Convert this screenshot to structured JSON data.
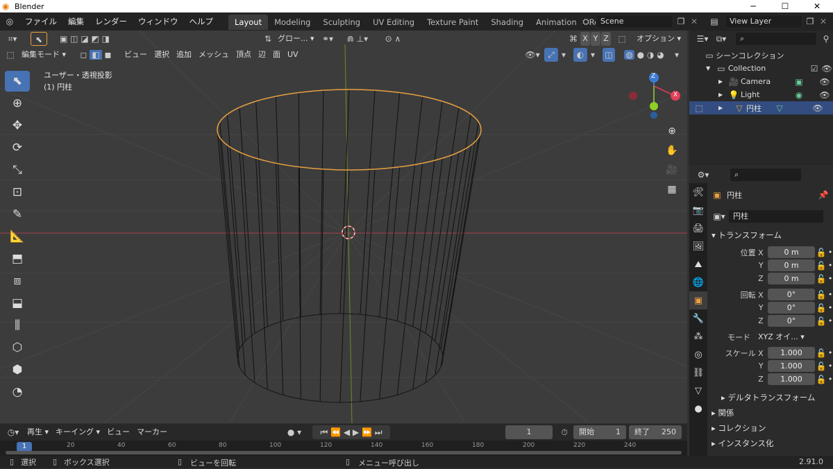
{
  "window": {
    "title": "Blender",
    "minimize": "─",
    "maximize": "☐",
    "close": "✕"
  },
  "menu": {
    "items": [
      "ファイル",
      "編集",
      "レンダー",
      "ウィンドウ",
      "ヘルプ"
    ],
    "workspaces": [
      "Layout",
      "Modeling",
      "Sculpting",
      "UV Editing",
      "Texture Paint",
      "Shading",
      "Animation",
      "Rendering"
    ],
    "active_workspace": "Layout",
    "scene": "Scene",
    "view_layer": "View Layer"
  },
  "viewport_header": {
    "transform_orientation": "グロー...",
    "xyz": [
      "X",
      "Y",
      "Z"
    ],
    "options": "オプション",
    "mode": "編集モード",
    "menus": [
      "ビュー",
      "選択",
      "追加",
      "メッシュ",
      "頂点",
      "辺",
      "面",
      "UV"
    ]
  },
  "viewport": {
    "view_label": "ユーザー・透視投影",
    "object_label": "(1) 円柱",
    "gizmo_axes": {
      "z": "Z",
      "x": "X"
    }
  },
  "outliner": {
    "scene_collection": "シーンコレクション",
    "items": [
      {
        "name": "Collection"
      },
      {
        "name": "Camera"
      },
      {
        "name": "Light"
      },
      {
        "name": "円柱"
      }
    ]
  },
  "properties": {
    "object_name": "円柱",
    "datablock": "円柱",
    "transform_label": "トランスフォーム",
    "location": {
      "label": "位置",
      "x": "0 m",
      "y": "0 m",
      "z": "0 m"
    },
    "rotation": {
      "label": "回転",
      "x": "0°",
      "y": "0°",
      "z": "0°"
    },
    "mode_label": "モード",
    "mode_value": "XYZ オイ...",
    "scale": {
      "label": "スケール",
      "x": "1.000",
      "y": "1.000",
      "z": "1.000"
    },
    "axis": {
      "x": "X",
      "y": "Y",
      "z": "Z"
    },
    "panels": [
      "デルタトランスフォーム",
      "関係",
      "コレクション",
      "インスタンス化"
    ]
  },
  "timeline": {
    "menus": [
      "再生",
      "キーイング",
      "ビュー",
      "マーカー"
    ],
    "current_frame": "1",
    "start_label": "開始",
    "start": "1",
    "end_label": "終了",
    "end": "250",
    "ruler_current": "1",
    "ruler_ticks": [
      "20",
      "40",
      "60",
      "80",
      "100",
      "120",
      "140",
      "160",
      "180",
      "200",
      "220",
      "240"
    ]
  },
  "statusbar": {
    "select": "選択",
    "box_select": "ボックス選択",
    "rotate_view": "ビューを回転",
    "call_menu": "メニュー呼び出し",
    "version": "2.91.0"
  },
  "colors": {
    "accent": "#4772b3",
    "selected_edge": "#e8a040",
    "x_axis": "#c43c4e",
    "y_axis": "#83ad3a",
    "z_axis": "#3b7bd4"
  }
}
